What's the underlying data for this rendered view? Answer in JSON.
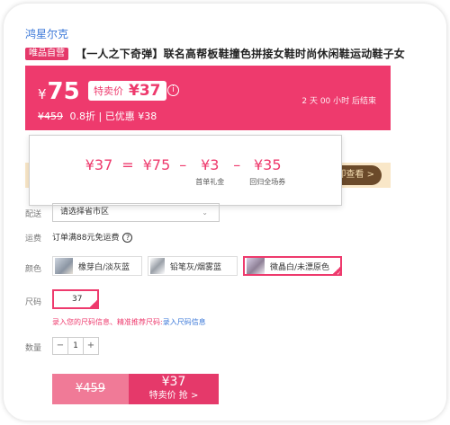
{
  "brand": "鸿星尔克",
  "product": {
    "badge": "唯品自营",
    "title": "【一人之下奇弹】联名高帮板鞋撞色拼接女鞋时尚休闲鞋运动鞋子女"
  },
  "price": {
    "yen": "¥",
    "current": "75",
    "special_label": "特卖价",
    "special_value": "¥37",
    "info_icon": "i",
    "original": "¥459",
    "discount": "0.8折",
    "saved": "| 已优惠 ¥38",
    "countdown": "2 天 00 小时 后结束"
  },
  "coupon": {
    "button": "即查看 >"
  },
  "breakdown": {
    "result": "¥37",
    "eq": "=",
    "base": "¥75",
    "minus1": "–",
    "gift": "¥3",
    "gift_caption": "首单礼金",
    "minus2": "–",
    "coupon": "¥35",
    "coupon_caption": "回归全场券"
  },
  "delivery": {
    "label": "配送",
    "placeholder": "请选择省市区",
    "chevron": "⌄"
  },
  "shipping": {
    "label": "运费",
    "text": "订单满88元免运费",
    "help": "?"
  },
  "colors": {
    "label": "颜色",
    "options": [
      "橡芽白/淡灰蓝",
      "铅笔灰/烟雾蓝",
      "微晶白/未漂原色"
    ],
    "selected_index": 2,
    "check": "✓"
  },
  "size": {
    "label": "尺码",
    "selected": "37",
    "hint_prefix": "录入您的尺码信息、精准推荐尺码:",
    "hint_link": "录入尺码信息"
  },
  "quantity": {
    "label": "数量",
    "minus": "−",
    "value": "1",
    "plus": "+"
  },
  "buy": {
    "original": "¥459",
    "special": "¥37",
    "action": "特卖价 抢 >"
  },
  "theme": {
    "accent": "#ee3a6d",
    "link": "#3b78d8"
  }
}
